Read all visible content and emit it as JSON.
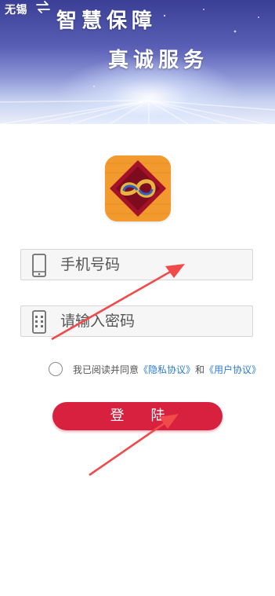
{
  "header": {
    "city": "无锡",
    "slogan_line1": "智慧保障",
    "slogan_line2": "真诚服务"
  },
  "form": {
    "phone_placeholder": "手机号码",
    "password_placeholder": "请输入密码"
  },
  "agreement": {
    "prefix": "我已阅读并同意",
    "privacy_link": "《隐私协议》",
    "connector": "和",
    "user_link": "《用户协议》",
    "checked": false
  },
  "login": {
    "label": "登陆"
  },
  "colors": {
    "primary": "#d8203f",
    "link": "#2b7cd3",
    "annotation_arrow": "#f04a4a"
  },
  "icons": {
    "city_switch": "swap-icon",
    "phone_field": "phone-icon",
    "password_field": "keypad-icon"
  }
}
